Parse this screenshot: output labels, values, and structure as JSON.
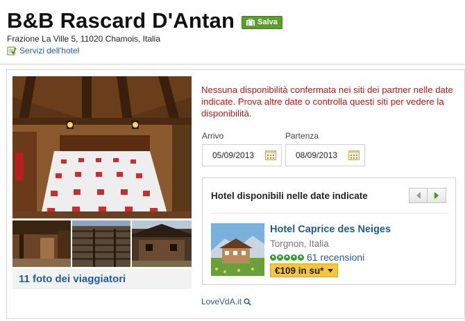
{
  "header": {
    "hotel_name": "B&B Rascard D'Antan",
    "save_label": "Salva",
    "address": "Frazione La Ville 5, 11020 Chamois, Italia",
    "services_link": "Servizi dell'hotel"
  },
  "gallery": {
    "traveler_photos_link": "11 foto dei viaggiatori"
  },
  "availability": {
    "message": "Nessuna disponibilità confermata nei siti dei partner nelle date indicate. Prova altre date o controlla questi siti per vedere la disponibilità.",
    "checkin_label": "Arrivo",
    "checkin_value": "05/09/2013",
    "checkout_label": "Partenza",
    "checkout_value": "08/09/2013"
  },
  "available_hotels": {
    "title": "Hotel disponibili nelle date indicate",
    "hotel": {
      "name": "Hotel Caprice des Neiges",
      "location": "Torgnon, Italia",
      "rating_bubbles": 5,
      "reviews": "61 recensioni",
      "price_label": "€109 in su*"
    }
  },
  "partner_link": "LoveVdA.it",
  "colors": {
    "link": "#1f5c9c",
    "alert": "#cc1111",
    "save_green": "#5a9e2c",
    "price_yellow": "#f5c53a",
    "rating_green": "#33a02c"
  }
}
